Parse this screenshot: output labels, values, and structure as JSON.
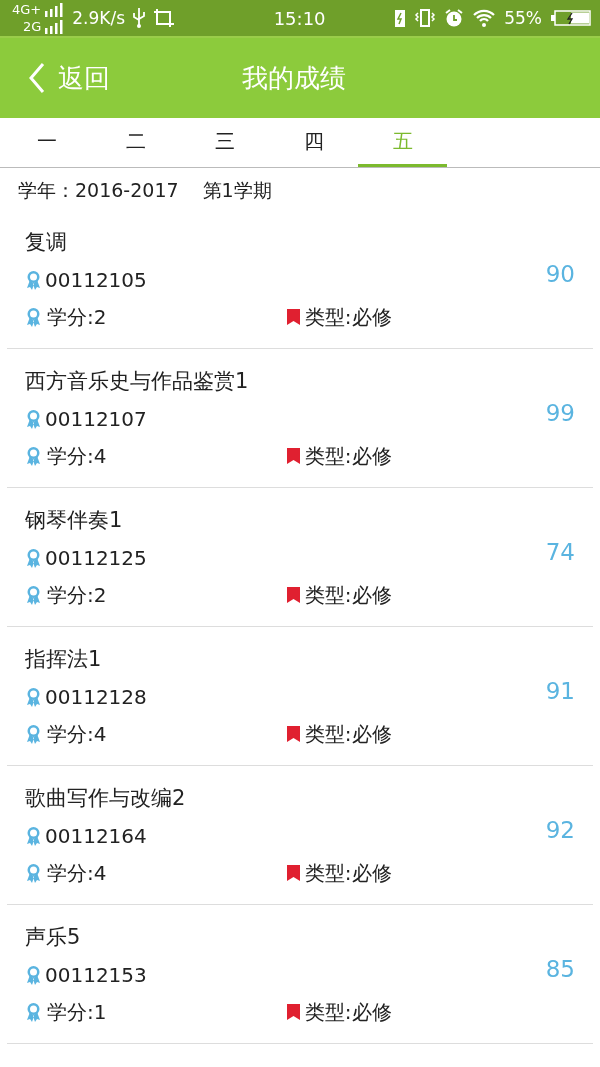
{
  "status_bar": {
    "network_top": "4G+",
    "network_bottom": "2G",
    "speed": "2.9K/s",
    "time": "15:10",
    "battery": "55%"
  },
  "header": {
    "back": "返回",
    "title": "我的成绩"
  },
  "tabs": [
    {
      "label": "一",
      "selected": false
    },
    {
      "label": "二",
      "selected": false
    },
    {
      "label": "三",
      "selected": false
    },
    {
      "label": "四",
      "selected": false
    },
    {
      "label": "五",
      "selected": true
    }
  ],
  "term": {
    "year": "学年：2016-2017",
    "semester": "第1学期"
  },
  "courses": [
    {
      "name": "复调",
      "code": "00112105",
      "credit": "学分:2",
      "type": "类型:必修",
      "score": "90"
    },
    {
      "name": "西方音乐史与作品鉴赏1",
      "code": "00112107",
      "credit": "学分:4",
      "type": "类型:必修",
      "score": "99"
    },
    {
      "name": "钢琴伴奏1",
      "code": "00112125",
      "credit": "学分:2",
      "type": "类型:必修",
      "score": "74"
    },
    {
      "name": "指挥法1",
      "code": "00112128",
      "credit": "学分:4",
      "type": "类型:必修",
      "score": "91"
    },
    {
      "name": "歌曲写作与改编2",
      "code": "00112164",
      "credit": "学分:4",
      "type": "类型:必修",
      "score": "92"
    },
    {
      "name": "声乐5",
      "code": "00112153",
      "credit": "学分:1",
      "type": "类型:必修",
      "score": "85"
    }
  ]
}
